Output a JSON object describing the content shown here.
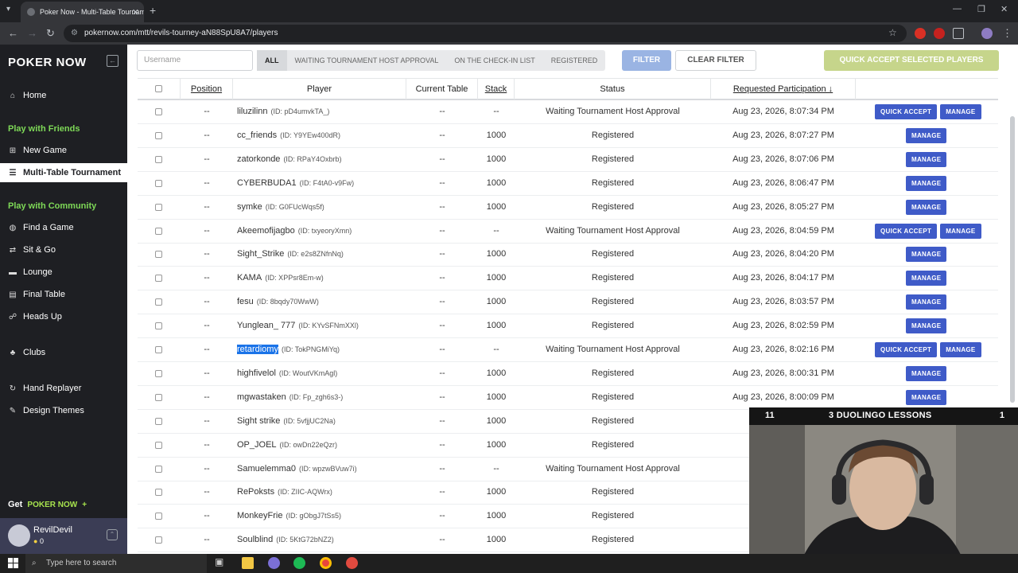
{
  "browser": {
    "tab_title": "Poker Now - Multi-Table Tournament",
    "url": "pokernow.com/mtt/revils-tourney-aN88SpU8A7/players"
  },
  "sidebar": {
    "logo": "POKER NOW",
    "home": "Home",
    "section_friends": "Play with Friends",
    "new_game": "New Game",
    "mtt": "Multi-Table Tournament",
    "section_community": "Play with Community",
    "find_game": "Find a Game",
    "sit_go": "Sit & Go",
    "lounge": "Lounge",
    "final_table": "Final Table",
    "heads_up": "Heads Up",
    "clubs": "Clubs",
    "hand_replayer": "Hand Replayer",
    "design_themes": "Design Themes",
    "get_label": "Get",
    "get_brand": "POKER NOW",
    "get_plus": "+",
    "user": {
      "name": "RevilDevil",
      "coins": "0"
    }
  },
  "filters": {
    "search_placeholder": "Username",
    "tabs": [
      "ALL",
      "WAITING TOURNAMENT HOST APPROVAL",
      "ON THE CHECK-IN LIST",
      "REGISTERED"
    ],
    "filter_btn": "FILTER",
    "clear_btn": "CLEAR FILTER",
    "quick_accept_selected": "QUICK ACCEPT SELECTED PLAYERS"
  },
  "table": {
    "headers": {
      "position": "Position",
      "player": "Player",
      "current_table": "Current Table",
      "stack": "Stack",
      "status": "Status",
      "requested": "Requested Participation ↓"
    },
    "action_labels": {
      "quick_accept": "QUICK ACCEPT",
      "manage": "MANAGE"
    },
    "rows": [
      {
        "position": "--",
        "name": "liluzilinn",
        "id": "(ID: pD4umvkTA_)",
        "table": "--",
        "stack": "--",
        "status": "Waiting Tournament Host Approval",
        "requested": "Aug 23, 2026, 8:07:34 PM",
        "quick": true
      },
      {
        "position": "--",
        "name": "cc_friends",
        "id": "(ID: Y9YEw400dR)",
        "table": "--",
        "stack": "1000",
        "status": "Registered",
        "requested": "Aug 23, 2026, 8:07:27 PM",
        "quick": false
      },
      {
        "position": "--",
        "name": "zatorkonde",
        "id": "(ID: RPaY4Oxbrb)",
        "table": "--",
        "stack": "1000",
        "status": "Registered",
        "requested": "Aug 23, 2026, 8:07:06 PM",
        "quick": false
      },
      {
        "position": "--",
        "name": "CYBERBUDA1",
        "id": "(ID: F4tA0-v9Fw)",
        "table": "--",
        "stack": "1000",
        "status": "Registered",
        "requested": "Aug 23, 2026, 8:06:47 PM",
        "quick": false
      },
      {
        "position": "--",
        "name": "symke",
        "id": "(ID: G0FUcWqs5f)",
        "table": "--",
        "stack": "1000",
        "status": "Registered",
        "requested": "Aug 23, 2026, 8:05:27 PM",
        "quick": false
      },
      {
        "position": "--",
        "name": "Akeemofijagbo",
        "id": "(ID: txyeoryXmn)",
        "table": "--",
        "stack": "--",
        "status": "Waiting Tournament Host Approval",
        "requested": "Aug 23, 2026, 8:04:59 PM",
        "quick": true
      },
      {
        "position": "--",
        "name": "Sight_Strike",
        "id": "(ID: e2s8ZNfnNq)",
        "table": "--",
        "stack": "1000",
        "status": "Registered",
        "requested": "Aug 23, 2026, 8:04:20 PM",
        "quick": false
      },
      {
        "position": "--",
        "name": "KAMA",
        "id": "(ID: XPPsr8Em-w)",
        "table": "--",
        "stack": "1000",
        "status": "Registered",
        "requested": "Aug 23, 2026, 8:04:17 PM",
        "quick": false
      },
      {
        "position": "--",
        "name": "fesu",
        "id": "(ID: 8bqdy70WwW)",
        "table": "--",
        "stack": "1000",
        "status": "Registered",
        "requested": "Aug 23, 2026, 8:03:57 PM",
        "quick": false
      },
      {
        "position": "--",
        "name": "Yunglean_ 777",
        "id": "(ID: KYvSFNmXXl)",
        "table": "--",
        "stack": "1000",
        "status": "Registered",
        "requested": "Aug 23, 2026, 8:02:59 PM",
        "quick": false
      },
      {
        "position": "--",
        "name": "retardiomy",
        "id": "(ID: TokPNGMiYq)",
        "table": "--",
        "stack": "--",
        "status": "Waiting Tournament Host Approval",
        "requested": "Aug 23, 2026, 8:02:16 PM",
        "quick": true,
        "selected": true
      },
      {
        "position": "--",
        "name": "highfivelol",
        "id": "(ID: WoutVKmAgl)",
        "table": "--",
        "stack": "1000",
        "status": "Registered",
        "requested": "Aug 23, 2026, 8:00:31 PM",
        "quick": false
      },
      {
        "position": "--",
        "name": "mgwastaken",
        "id": "(ID: Fp_zgh6s3-)",
        "table": "--",
        "stack": "1000",
        "status": "Registered",
        "requested": "Aug 23, 2026, 8:00:09 PM",
        "quick": false
      },
      {
        "position": "--",
        "name": "Sight strike",
        "id": "(ID: 5vfjjUC2Na)",
        "table": "--",
        "stack": "1000",
        "status": "Registered",
        "requested": "Aug",
        "quick": false,
        "hidden_actions": true
      },
      {
        "position": "--",
        "name": "OP_JOEL",
        "id": "(ID: owDn22eQzr)",
        "table": "--",
        "stack": "1000",
        "status": "Registered",
        "requested": "Aug",
        "quick": false,
        "hidden_actions": true
      },
      {
        "position": "--",
        "name": "Samuelemma0",
        "id": "(ID: wpzwBVuw7i)",
        "table": "--",
        "stack": "--",
        "status": "Waiting Tournament Host Approval",
        "requested": "Aug",
        "quick": false,
        "hidden_actions": true
      },
      {
        "position": "--",
        "name": "RePoksts",
        "id": "(ID: ZIIC-AQWrx)",
        "table": "--",
        "stack": "1000",
        "status": "Registered",
        "requested": "Aug",
        "quick": false,
        "hidden_actions": true
      },
      {
        "position": "--",
        "name": "MonkeyFrie",
        "id": "(ID: gObgJ7tSs5)",
        "table": "--",
        "stack": "1000",
        "status": "Registered",
        "requested": "Aug",
        "quick": false,
        "hidden_actions": true
      },
      {
        "position": "--",
        "name": "Soulblind",
        "id": "(ID: 5KtG72bNZ2)",
        "table": "--",
        "stack": "1000",
        "status": "Registered",
        "requested": "Aug",
        "quick": false,
        "hidden_actions": true
      }
    ]
  },
  "overlay": {
    "left": "11",
    "center": "3 DUOLINGO LESSONS",
    "right": "1"
  },
  "taskbar": {
    "search_placeholder": "Type here to search"
  }
}
